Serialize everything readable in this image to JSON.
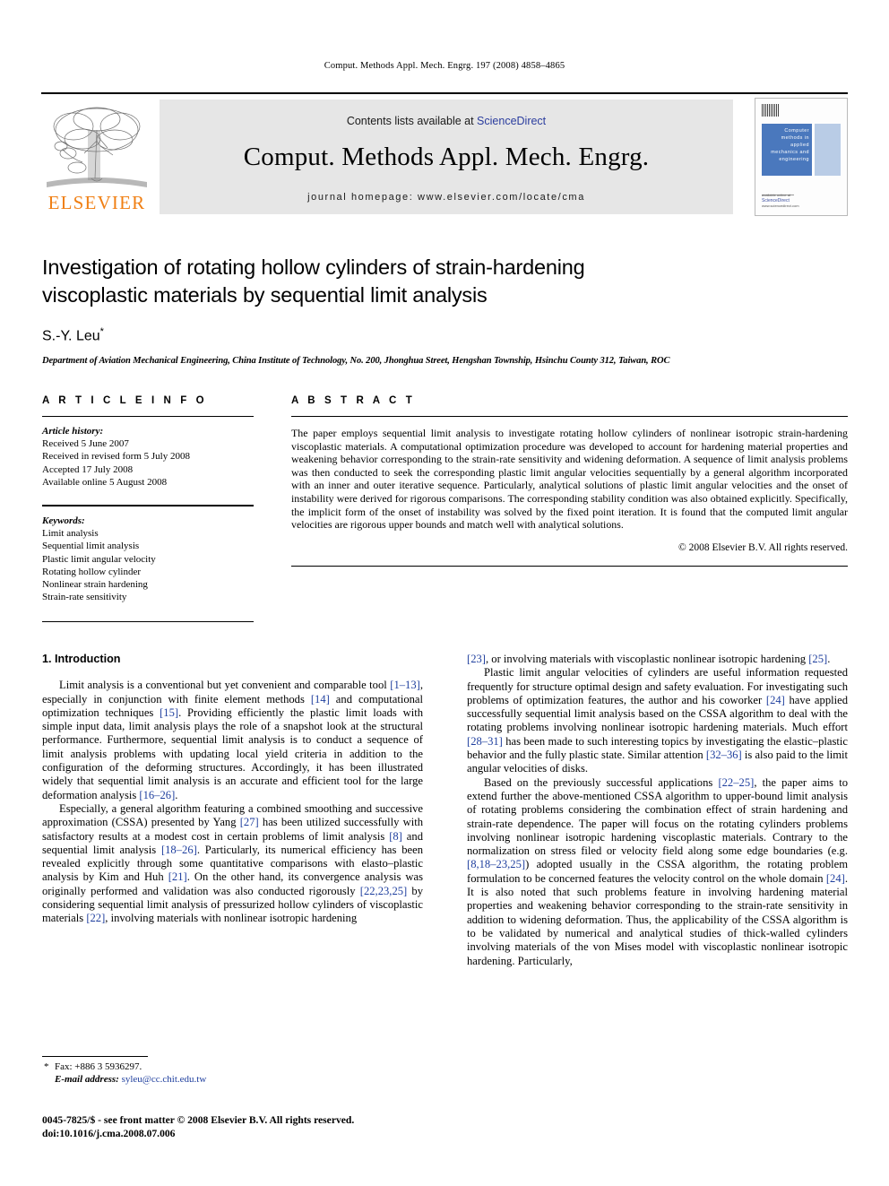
{
  "running_head": "Comput. Methods Appl. Mech. Engrg. 197 (2008) 4858–4865",
  "masthead": {
    "publisher_logo_text": "ELSEVIER",
    "contents_prefix": "Contents lists available at ",
    "contents_link": "ScienceDirect",
    "journal_title": "Comput. Methods Appl. Mech. Engrg.",
    "homepage_line": "journal homepage: www.elsevier.com/locate/cma",
    "cover": {
      "title_lines": "Computer methods in applied mechanics and engineering",
      "sciencedirect_label": "ScienceDirect",
      "available_label": "available online at",
      "publisher_label": "www.sciencedirect.com",
      "corner_label": "An Elsevier publication"
    }
  },
  "article": {
    "title": "Investigation of rotating hollow cylinders of strain-hardening viscoplastic materials by sequential limit analysis",
    "author": "S.-Y. Leu",
    "author_marker": "*",
    "affiliation": "Department of Aviation Mechanical Engineering, China Institute of Technology, No. 200, Jhonghua Street, Hengshan Township, Hsinchu County 312, Taiwan, ROC"
  },
  "info": {
    "heading": "A R T I C L E   I N F O",
    "history_label": "Article history:",
    "history": [
      "Received 5 June 2007",
      "Received in revised form 5 July 2008",
      "Accepted 17 July 2008",
      "Available online 5 August 2008"
    ],
    "keywords_label": "Keywords:",
    "keywords": [
      "Limit analysis",
      "Sequential limit analysis",
      "Plastic limit angular velocity",
      "Rotating hollow cylinder",
      "Nonlinear strain hardening",
      "Strain-rate sensitivity"
    ]
  },
  "abstract": {
    "heading": "A B S T R A C T",
    "text": "The paper employs sequential limit analysis to investigate rotating hollow cylinders of nonlinear isotropic strain-hardening viscoplastic materials. A computational optimization procedure was developed to account for hardening material properties and weakening behavior corresponding to the strain-rate sensitivity and widening deformation. A sequence of limit analysis problems was then conducted to seek the corresponding plastic limit angular velocities sequentially by a general algorithm incorporated with an inner and outer iterative sequence. Particularly, analytical solutions of plastic limit angular velocities and the onset of instability were derived for rigorous comparisons. The corresponding stability condition was also obtained explicitly. Specifically, the implicit form of the onset of instability was solved by the fixed point iteration. It is found that the computed limit angular velocities are rigorous upper bounds and match well with analytical solutions.",
    "copyright": "© 2008 Elsevier B.V. All rights reserved."
  },
  "body": {
    "section_heading": "1. Introduction",
    "left": {
      "p1_a": "Limit analysis is a conventional but yet convenient and comparable tool ",
      "p1_r1": "[1–13]",
      "p1_b": ", especially in conjunction with finite element methods ",
      "p1_r2": "[14]",
      "p1_c": " and computational optimization techniques ",
      "p1_r3": "[15]",
      "p1_d": ". Providing efficiently the plastic limit loads with simple input data, limit analysis plays the role of a snapshot look at the structural performance. Furthermore, sequential limit analysis is to conduct a sequence of limit analysis problems with updating local yield criteria in addition to the configuration of the deforming structures. Accordingly, it has been illustrated widely that sequential limit analysis is an accurate and efficient tool for the large deformation analysis ",
      "p1_r4": "[16–26]",
      "p1_e": ".",
      "p2_a": "Especially, a general algorithm featuring a combined smoothing and successive approximation (CSSA) presented by Yang ",
      "p2_r1": "[27]",
      "p2_b": " has been utilized successfully with satisfactory results at a modest cost in certain problems of limit analysis ",
      "p2_r2": "[8]",
      "p2_c": " and sequential limit analysis ",
      "p2_r3": "[18–26]",
      "p2_d": ". Particularly, its numerical efficiency has been revealed explicitly through some quantitative comparisons with elasto–plastic analysis by Kim and Huh ",
      "p2_r4": "[21]",
      "p2_e": ". On the other hand, its convergence analysis was originally performed and validation was also conducted rigorously ",
      "p2_r5": "[22,23,25]",
      "p2_f": " by considering sequential limit analysis of pressurized hollow cylinders of viscoplastic materials ",
      "p2_r6": "[22]",
      "p2_g": ", involving materials with nonlinear isotropic hardening"
    },
    "right": {
      "p1_r1": "[23]",
      "p1_a": ", or involving materials with viscoplastic nonlinear isotropic hardening ",
      "p1_r2": "[25]",
      "p1_b": ".",
      "p2_a": "Plastic limit angular velocities of cylinders are useful information requested frequently for structure optimal design and safety evaluation. For investigating such problems of optimization features, the author and his coworker ",
      "p2_r1": "[24]",
      "p2_b": " have applied successfully sequential limit analysis based on the CSSA algorithm to deal with the rotating problems involving nonlinear isotropic hardening materials. Much effort ",
      "p2_r2": "[28–31]",
      "p2_c": " has been made to such interesting topics by investigating the elastic–plastic behavior and the fully plastic state. Similar attention ",
      "p2_r3": "[32–36]",
      "p2_d": " is also paid to the limit angular velocities of disks.",
      "p3_a": "Based on the previously successful applications ",
      "p3_r1": "[22–25]",
      "p3_b": ", the paper aims to extend further the above-mentioned CSSA algorithm to upper-bound limit analysis of rotating problems considering the combination effect of strain hardening and strain-rate dependence. The paper will focus on the rotating cylinders problems involving nonlinear isotropic hardening viscoplastic materials. Contrary to the normalization on stress filed or velocity field along some edge boundaries (e.g. ",
      "p3_r2": "[8,18–23,25]",
      "p3_c": ") adopted usually in the CSSA algorithm, the rotating problem formulation to be concerned features the velocity control on the whole domain ",
      "p3_r3": "[24]",
      "p3_d": ". It is also noted that such problems feature in involving hardening material properties and weakening behavior corresponding to the strain-rate sensitivity in addition to widening deformation. Thus, the applicability of the CSSA algorithm is to be validated by numerical and analytical studies of thick-walled cylinders involving materials of the von Mises model with viscoplastic nonlinear isotropic hardening. Particularly,"
    }
  },
  "footnotes": {
    "fax": "Fax: +886 3 5936297.",
    "email_label": "E-mail address:",
    "email": "syleu@cc.chit.edu.tw",
    "marker": "*"
  },
  "issn_line": "0045-7825/$ - see front matter © 2008 Elsevier B.V. All rights reserved.",
  "doi_line": "doi:10.1016/j.cma.2008.07.006",
  "colors": {
    "link": "#2b3d9e",
    "reference": "#1f3f9e",
    "elsevier_orange": "#F07F13",
    "cover_blue": "#4a78bd",
    "band_gray": "#e6e6e6"
  }
}
